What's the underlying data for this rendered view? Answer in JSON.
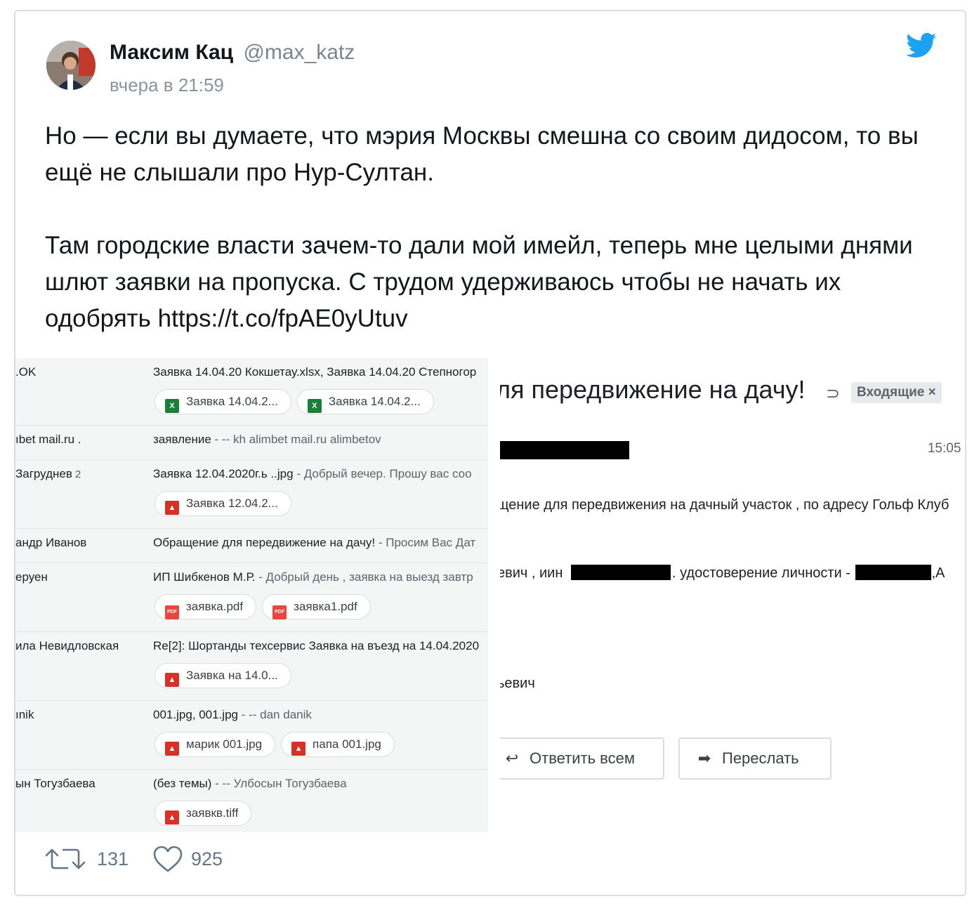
{
  "tweet": {
    "author_name": "Максим Кац",
    "author_handle": "@max_katz",
    "time": "вчера в 21:59",
    "paragraph1": "Но — если вы думаете, что мэрия Москвы смешна со своим дидосом, то вы ещё не слышали про Нур-Султан.",
    "paragraph2": "Там городские власти зачем-то дали мой имейл, теперь мне целыми днями шлют заявки на пропуска. С трудом удерживаюсь чтобы не начать их одобрять https://t.co/fpAE0yUtuv",
    "retweets": "131",
    "likes": "925"
  },
  "inbox": {
    "rows": [
      {
        "sender": ".OK",
        "count": "",
        "subject": "Заявка 14.04.20 Кокшетау.xlsx, Заявка 14.04.20 Степногор",
        "snippet": "",
        "attachments": [
          {
            "label": "Заявка 14.04.2...",
            "icon": "excel-icon"
          },
          {
            "label": "Заявка 14.04.2...",
            "icon": "excel-icon"
          }
        ]
      },
      {
        "sender": "ıbet mail.ru .",
        "count": "",
        "subject": "заявление",
        "snippet": " - -- kh alimbet mail.ru alimbetov",
        "attachments": []
      },
      {
        "sender": "Загруднев",
        "count": "2",
        "subject": "Заявка 12.04.2020г.ь ..jpg",
        "snippet": " - Добрый вечер. Прошу вас соо",
        "attachments": [
          {
            "label": "Заявка 12.04.2...",
            "icon": "image-icon"
          }
        ]
      },
      {
        "sender": "андр Иванов",
        "count": "",
        "subject": "Обращение для передвижение на дачу!",
        "snippet": " - Просим Вас Дат",
        "attachments": []
      },
      {
        "sender": "еруен",
        "count": "",
        "subject": "ИП Шибкенов М.Р.",
        "snippet": " - Добрый день , заявка на выезд завтр",
        "attachments": [
          {
            "label": "заявка.pdf",
            "icon": "pdf-icon"
          },
          {
            "label": "заявка1.pdf",
            "icon": "pdf-icon"
          }
        ]
      },
      {
        "sender": "ила Невидловская",
        "count": "",
        "subject": "Re[2]: Шортанды техсервис Заявка на въезд на 14.04.2020",
        "snippet": "",
        "attachments": [
          {
            "label": "Заявка на 14.0...",
            "icon": "image-icon"
          }
        ]
      },
      {
        "sender": "ınik",
        "count": "",
        "subject": "001.jpg, 001.jpg",
        "snippet": " - -- dan danik",
        "attachments": [
          {
            "label": "марик 001.jpg",
            "icon": "image-icon"
          },
          {
            "label": "папа 001.jpg",
            "icon": "image-icon"
          }
        ]
      },
      {
        "sender": "ын Тогузбаева",
        "count": "",
        "subject": "(без темы)",
        "snippet": " - -- Улбосын Тогузбаева",
        "attachments": [
          {
            "label": "заявкв.tiff",
            "icon": "image-icon"
          }
        ]
      }
    ]
  },
  "email": {
    "subject": "ля передвижение на дачу!",
    "label_badge": "Входящие ×",
    "time": "15:05 (",
    "line1": "щение для передвижения на дачный участок , по адресу Гольф Клуб",
    "line2_a": "евич , иин",
    "line2_b": ". удостоверение личности -",
    "line2_c": ",А",
    "line3": "ьевич",
    "reply_all": "Ответить всем",
    "forward": "Переслать"
  }
}
